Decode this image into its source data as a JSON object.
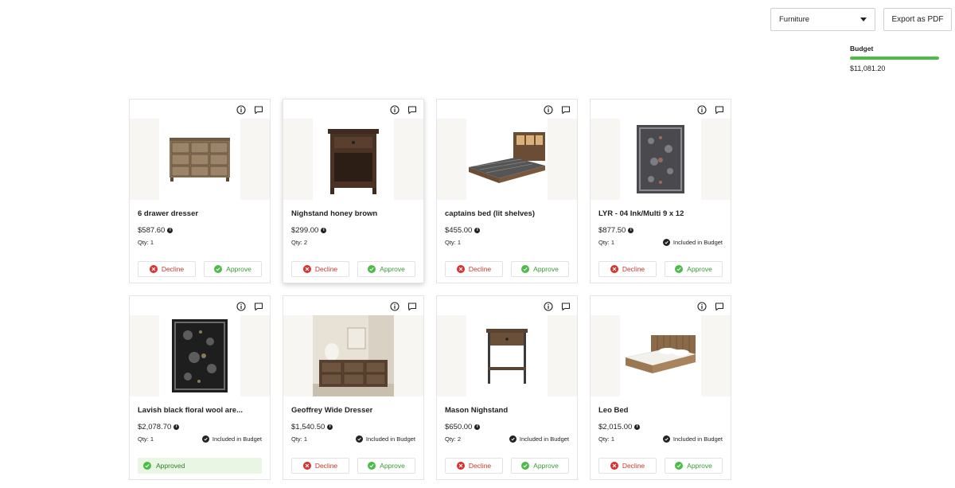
{
  "header": {
    "category_select": "Furniture",
    "export_label": "Export as PDF"
  },
  "budget": {
    "label": "Budget",
    "amount": "$11,081.20",
    "progress_fraction": 1.0,
    "bar_color": "#4cbb47"
  },
  "labels": {
    "decline": "Decline",
    "approve": "Approve",
    "approved": "Approved",
    "included": "Included in Budget"
  },
  "products": [
    {
      "name": "6 drawer dresser",
      "price": "$587.60",
      "qty": "Qty: 1",
      "included": false,
      "status": "pending",
      "image": "dresser"
    },
    {
      "name": "Nighstand honey brown",
      "price": "$299.00",
      "qty": "Qty: 2",
      "included": false,
      "status": "pending",
      "image": "nightstand-dark"
    },
    {
      "name": "captains bed (lit shelves)",
      "price": "$455.00",
      "qty": "Qty: 1",
      "included": false,
      "status": "pending",
      "image": "bed-captain"
    },
    {
      "name": "LYR - 04 Ink/Multi 9 x 12",
      "price": "$877.50",
      "qty": "Qty: 1",
      "included": true,
      "status": "pending",
      "image": "rug-grey"
    },
    {
      "name": "Lavish black floral wool are...",
      "price": "$2,078.70",
      "qty": "Qty: 1",
      "included": true,
      "status": "approved",
      "image": "rug-black"
    },
    {
      "name": "Geoffrey Wide Dresser",
      "price": "$1,540.50",
      "qty": "Qty: 1",
      "included": true,
      "status": "pending",
      "image": "dresser-room"
    },
    {
      "name": "Mason Nighstand",
      "price": "$650.00",
      "qty": "Qty: 2",
      "included": true,
      "status": "pending",
      "image": "nightstand-open"
    },
    {
      "name": "Leo Bed",
      "price": "$2,015.00",
      "qty": "Qty: 1",
      "included": true,
      "status": "pending",
      "image": "bed-leo"
    }
  ]
}
